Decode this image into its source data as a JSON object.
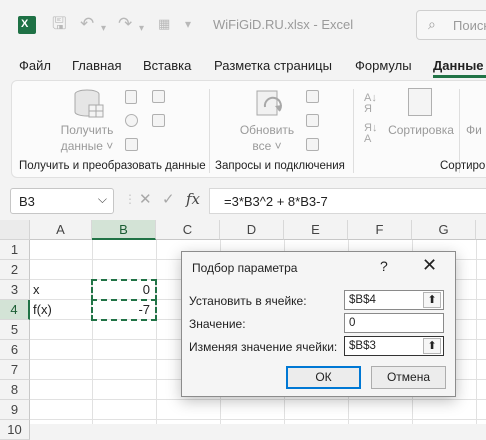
{
  "title_bar": {
    "file_name": "WiFiGiD.RU.xlsx  -  Excel",
    "search_placeholder": "Поиск"
  },
  "tabs": [
    "Файл",
    "Главная",
    "Вставка",
    "Разметка страницы",
    "Формулы",
    "Данные"
  ],
  "active_tab": "Данные",
  "ribbon": {
    "get_data_line1": "Получить",
    "get_data_line2": "данные ˅",
    "refresh_line1": "Обновить",
    "refresh_line2": "все ˅",
    "sort_label": "Сортировка",
    "filter_label": "Фи",
    "group1_title": "Получить и преобразовать данные",
    "group2_title": "Запросы и подключения",
    "group3_title": "Сортиро"
  },
  "formula_bar": {
    "name_box": "B3",
    "fx_label": "fx",
    "formula": "=3*B3^2 + 8*B3-7"
  },
  "grid": {
    "columns": [
      "A",
      "B",
      "C",
      "D",
      "E",
      "F",
      "G"
    ],
    "rows": [
      "1",
      "2",
      "3",
      "4",
      "5",
      "6",
      "7",
      "8",
      "9",
      "10"
    ],
    "cells": {
      "A3": "x",
      "B3": "0",
      "A4": "f(x)",
      "B4": "-7"
    }
  },
  "dialog": {
    "title": "Подбор параметра",
    "help": "?",
    "set_cell_label": "Установить в ячейке:",
    "set_cell_value": "$B$4",
    "to_value_label": "Значение:",
    "to_value_value": "0",
    "by_changing_label": "Изменяя значение ячейки:",
    "by_changing_value": "$B$3",
    "ok_label": "ОК",
    "cancel_label": "Отмена"
  },
  "colors": {
    "excel_green": "#217346",
    "selection_fill": "#d3e3d6",
    "focus_blue": "#0078d4"
  }
}
